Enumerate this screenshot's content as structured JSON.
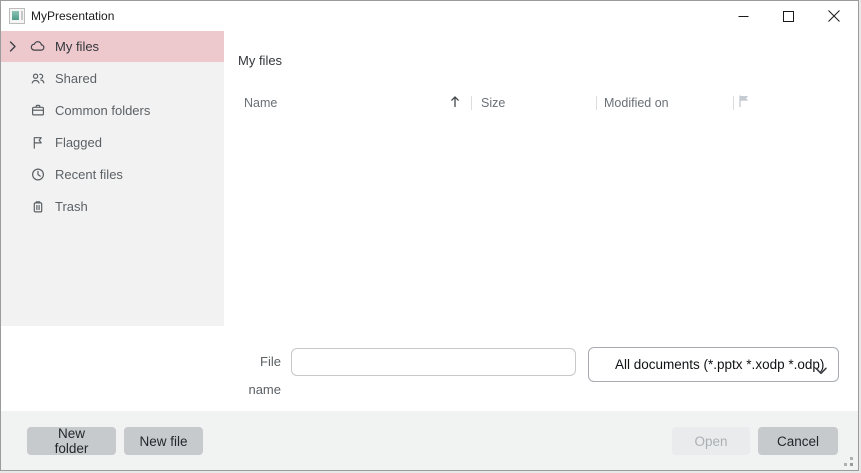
{
  "window": {
    "title": "MyPresentation"
  },
  "sidebar": {
    "items": [
      {
        "label": "My files",
        "icon": "cloud-icon",
        "selected": true
      },
      {
        "label": "Shared",
        "icon": "people-icon",
        "selected": false
      },
      {
        "label": "Common folders",
        "icon": "briefcase-icon",
        "selected": false
      },
      {
        "label": "Flagged",
        "icon": "flag-icon",
        "selected": false
      },
      {
        "label": "Recent files",
        "icon": "clock-icon",
        "selected": false
      },
      {
        "label": "Trash",
        "icon": "trash-icon",
        "selected": false
      }
    ]
  },
  "main": {
    "heading": "My files",
    "columns": [
      {
        "label": "Name",
        "sort": "ascending"
      },
      {
        "label": "Size"
      },
      {
        "label": "Modified on"
      },
      {
        "label": "",
        "icon": "flag-icon"
      }
    ],
    "rows": []
  },
  "file_form": {
    "label": "File name",
    "value": "",
    "filter_selected": "All documents (*.pptx *.xodp *.odp)"
  },
  "footer": {
    "new_folder_label": "New folder",
    "new_file_label": "New file",
    "open_label": "Open",
    "cancel_label": "Cancel",
    "open_enabled": false
  },
  "colors": {
    "selected_item_bg": "#edc9ce",
    "sidebar_bg": "#f2f2f2",
    "footer_bg": "#f1f2f2",
    "button_bg": "#c7cacc",
    "button_disabled_bg": "#e9ebec",
    "app_icon_teal": "#4e9b8a"
  }
}
